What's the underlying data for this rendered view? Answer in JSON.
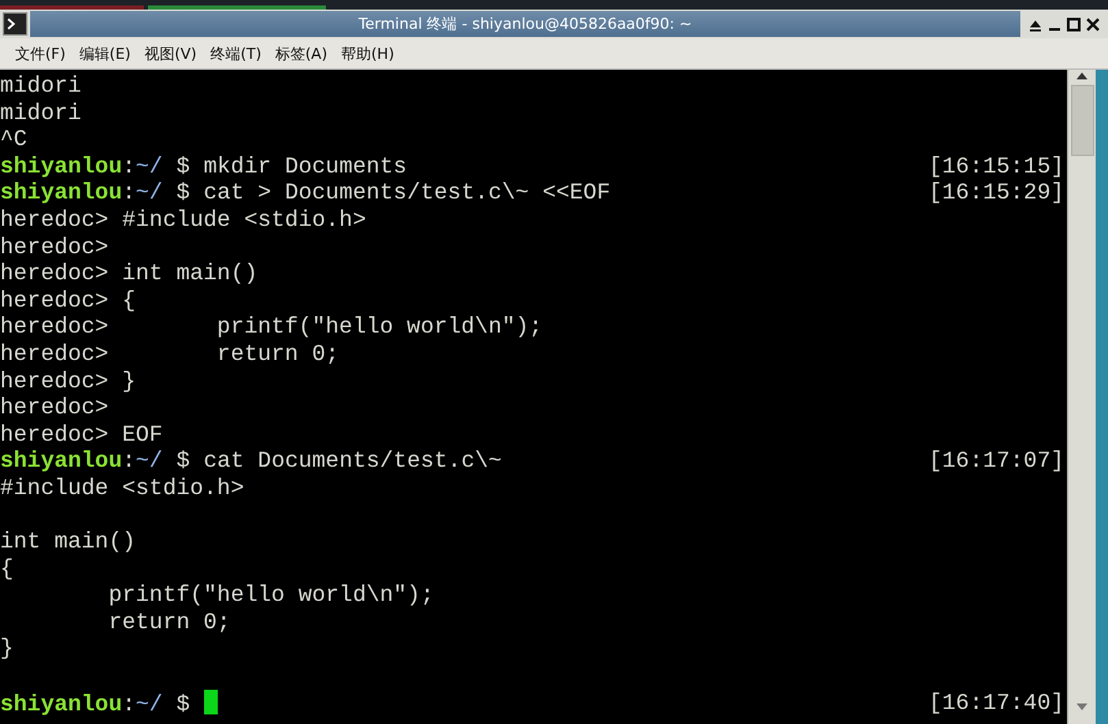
{
  "window": {
    "title": "Terminal 终端 - shiyanlou@405826aa0f90: ~"
  },
  "menu": [
    "文件(F)",
    "编辑(E)",
    "视图(V)",
    "终端(T)",
    "标签(A)",
    "帮助(H)"
  ],
  "lines": [
    {
      "kind": "output",
      "text": "midori"
    },
    {
      "kind": "output",
      "text": "midori"
    },
    {
      "kind": "output",
      "text": "^C"
    },
    {
      "kind": "prompt",
      "user": "shiyanlou",
      "sep": ":",
      "path": "~/",
      "symbol": "$",
      "command": "mkdir Documents",
      "time": "[16:15:15]",
      "cursor": false
    },
    {
      "kind": "prompt",
      "user": "shiyanlou",
      "sep": ":",
      "path": "~/",
      "symbol": "$",
      "command": "cat > Documents/test.c\\~ <<EOF",
      "time": "[16:15:29]",
      "cursor": false
    },
    {
      "kind": "output",
      "text": "heredoc> #include <stdio.h>"
    },
    {
      "kind": "output",
      "text": "heredoc>"
    },
    {
      "kind": "output",
      "text": "heredoc> int main()"
    },
    {
      "kind": "output",
      "text": "heredoc> {"
    },
    {
      "kind": "output",
      "text": "heredoc>        printf(\"hello world\\n\");"
    },
    {
      "kind": "output",
      "text": "heredoc>        return 0;"
    },
    {
      "kind": "output",
      "text": "heredoc> }"
    },
    {
      "kind": "output",
      "text": "heredoc>"
    },
    {
      "kind": "output",
      "text": "heredoc> EOF"
    },
    {
      "kind": "prompt",
      "user": "shiyanlou",
      "sep": ":",
      "path": "~/",
      "symbol": "$",
      "command": "cat Documents/test.c\\~",
      "time": "[16:17:07]",
      "cursor": false
    },
    {
      "kind": "output",
      "text": "#include <stdio.h>"
    },
    {
      "kind": "blank"
    },
    {
      "kind": "output",
      "text": "int main()"
    },
    {
      "kind": "output",
      "text": "{"
    },
    {
      "kind": "output",
      "text": "        printf(\"hello world\\n\");"
    },
    {
      "kind": "output",
      "text": "        return 0;"
    },
    {
      "kind": "output",
      "text": "}"
    },
    {
      "kind": "blank"
    },
    {
      "kind": "prompt",
      "user": "shiyanlou",
      "sep": ":",
      "path": "~/",
      "symbol": "$",
      "time": "[16:17:40]",
      "cursor": true
    }
  ]
}
